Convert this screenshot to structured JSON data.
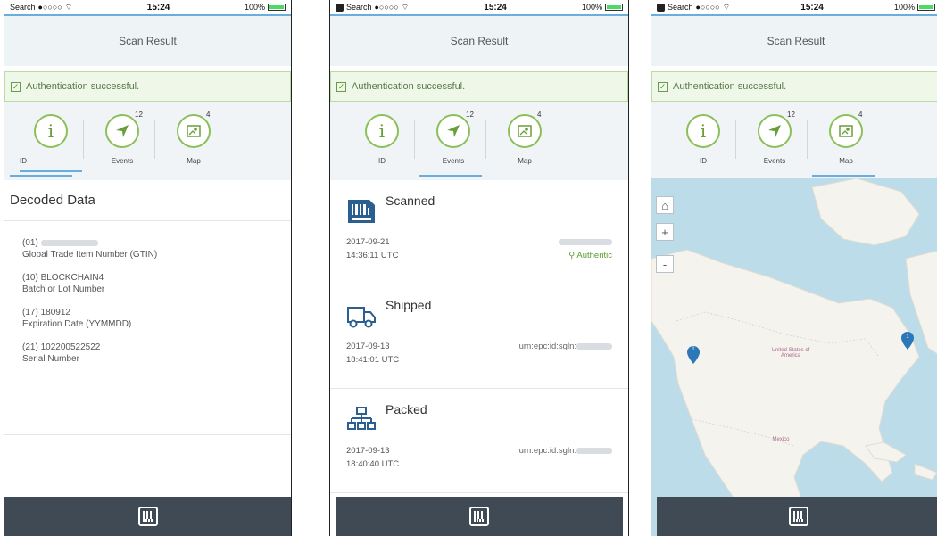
{
  "status": {
    "carrier": "Search",
    "signal": "●○○○○",
    "time": "15:24",
    "battery": "100%"
  },
  "header": {
    "title": "Scan Result"
  },
  "auth": {
    "message": "Authentication successful."
  },
  "tabs": [
    {
      "label": "ID",
      "icon": "info-icon",
      "badge": ""
    },
    {
      "label": "Events",
      "icon": "navigation-arrow-icon",
      "badge": "12"
    },
    {
      "label": "Map",
      "icon": "map-icon",
      "badge": "4"
    }
  ],
  "decoded": {
    "title": "Decoded Data",
    "entries": [
      {
        "code": "(01)",
        "value": "",
        "label": "Global Trade Item Number (GTIN)"
      },
      {
        "code": "(10)",
        "value": "BLOCKCHAIN4",
        "label": "Batch or Lot Number"
      },
      {
        "code": "(17)",
        "value": "180912",
        "label": "Expiration Date (YYMMDD)"
      },
      {
        "code": "(21)",
        "value": "102200522522",
        "label": "Serial Number"
      }
    ]
  },
  "events": [
    {
      "title": "Scanned",
      "icon": "barcode-scan-icon",
      "date": "2017-09-21",
      "time": "14:36:11 UTC",
      "right_top": "",
      "right_bottom": "Authentic"
    },
    {
      "title": "Shipped",
      "icon": "truck-icon",
      "date": "2017-09-13",
      "time": "18:41:01 UTC",
      "right_top": "urn:epc:id:sgln:",
      "right_bottom": ""
    },
    {
      "title": "Packed",
      "icon": "hierarchy-icon",
      "date": "2017-09-13",
      "time": "18:40:40 UTC",
      "right_top": "urn:epc:id:sgln:",
      "right_bottom": ""
    }
  ],
  "map": {
    "controls": [
      {
        "symbol": "⌂",
        "icon": "home-icon"
      },
      {
        "symbol": "+",
        "icon": "zoom-in-icon"
      },
      {
        "symbol": "-",
        "icon": "zoom-out-icon"
      }
    ],
    "labels": {
      "country": "United States of America",
      "mexico": "Mexico"
    },
    "pins": [
      {
        "label": "1"
      },
      {
        "label": "1"
      }
    ]
  },
  "colors": {
    "accent": "#6aaede",
    "success": "#8cbf5a",
    "footer": "#3f4a55"
  }
}
